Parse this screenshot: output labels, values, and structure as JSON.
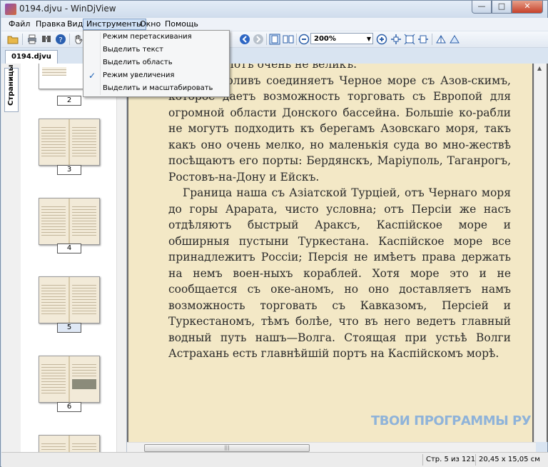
{
  "window": {
    "title": "0194.djvu - WinDjView"
  },
  "menu": {
    "items": [
      "Файл",
      "Правка",
      "Вид",
      "Инструменты",
      "Окно",
      "Помощь"
    ],
    "active_index": 3
  },
  "tools_menu": {
    "items": [
      {
        "label": "Режим перетаскивания",
        "checked": false
      },
      {
        "label": "Выделить текст",
        "checked": false
      },
      {
        "label": "Выделить область",
        "checked": false
      },
      {
        "label": "Режим увеличения",
        "checked": true
      },
      {
        "label": "Выделить и масштабировать",
        "checked": false
      }
    ],
    "check_glyph": "✓"
  },
  "toolbar": {
    "zoom_value": "200%"
  },
  "tab": {
    "label": "0194.djvu"
  },
  "sidebar": {
    "tab_label": "Страницы",
    "thumbnails": [
      {
        "label": "2"
      },
      {
        "label": "3"
      },
      {
        "label": "4"
      },
      {
        "label": "5",
        "selected": true
      },
      {
        "label": "6"
      }
    ]
  },
  "document": {
    "paragraphs": [
      "морскій флотъ очень не великъ.",
      "скій проливъ соединяетъ Черное море съ Азов-скимъ, которое даетъ возможность торговать съ Европой для огромной области Донского бассейна. Большіе ко-рабли не могутъ подходить къ берегамъ Азовскаго моря, такъ какъ оно очень мелко, но маленькія суда во мно-жествѣ посѣщаютъ его порты: Бердянскъ, Маріуполь, Таганрогъ, Ростовъ-на-Дону и Ейскъ.",
      "Граница наша съ Азіатской Турціей, отъ Чернаго моря до горы Арарата, чисто условна; отъ Персіи же насъ отдѣляютъ быстрый Араксъ, Каспійское море и обширныя пустыни Туркестана. Каспійское море все принадлежитъ Россіи; Персія не имѣетъ права держать на немъ воен-ныхъ кораблей. Хотя море это и не сообщается съ оке-аномъ, но оно доставляетъ намъ возможность торговать съ Кавказомъ, Персіей и Туркестаномъ, тѣмъ болѣе, что въ него ведетъ главный водный путь нашъ—Волга. Стоящая при устьѣ Волги Астрахань есть главнѣйшій портъ на Каспійскомъ морѣ."
    ],
    "watermark": "ТВОИ ПРОГРАММЫ РУ"
  },
  "status": {
    "page_info": "Стр. 5 из 121",
    "page_size": "20,45 x 15,05 см"
  },
  "icons": [
    "open-icon",
    "print-icon",
    "find-icon",
    "help-icon",
    "hand-icon",
    "prev-icon",
    "next-icon",
    "fit-page-icon",
    "two-page-icon",
    "zoom-out-icon",
    "zoom-in-icon",
    "rotate-left-icon",
    "rotate-right-icon"
  ]
}
